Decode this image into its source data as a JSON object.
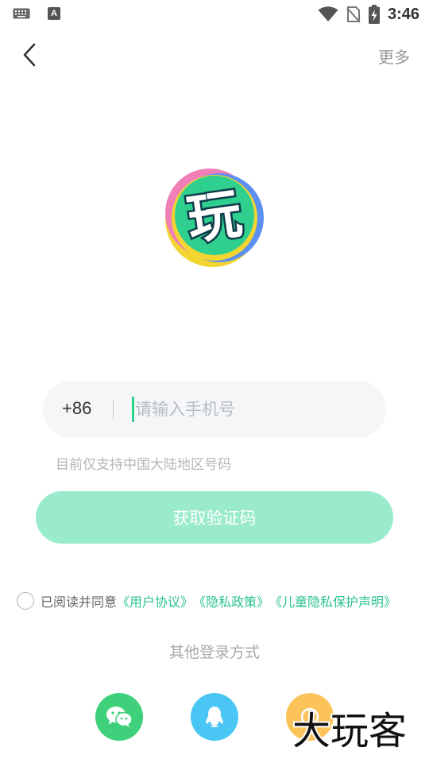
{
  "status_bar": {
    "time": "3:46",
    "left_icons": [
      "keyboard-icon",
      "text-a-icon"
    ],
    "right_icons": [
      "wifi-icon",
      "no-sim-icon",
      "battery-charging-icon"
    ]
  },
  "top_bar": {
    "back_icon": "chevron-left-icon",
    "more_label": "更多"
  },
  "logo": {
    "glyph": "玩",
    "colors": {
      "green": "#2fcf8f",
      "yellow": "#f2d531",
      "pink": "#ef7fb6",
      "blue": "#5b8ff0",
      "dark": "#0e3b4a"
    }
  },
  "phone": {
    "country_code": "+86",
    "placeholder": "请输入手机号",
    "value": ""
  },
  "hint": "目前仅支持中国大陆地区号码",
  "code_button_label": "获取验证码",
  "agreement": {
    "checked": false,
    "prefix": "已阅读并同意",
    "links": [
      "《用户协议》",
      "《隐私政策》",
      "《儿童隐私保护声明》"
    ]
  },
  "other_login": {
    "title": "其他登录方式",
    "methods": [
      "wechat-icon",
      "qq-icon",
      "third-login-icon"
    ]
  },
  "watermark": "大玩客",
  "colors": {
    "accent": "#2cc48d",
    "button_disabled": "#9aebcc",
    "wechat": "#3ed07a",
    "qq": "#4ac6f4",
    "third": "#fbc35a"
  }
}
